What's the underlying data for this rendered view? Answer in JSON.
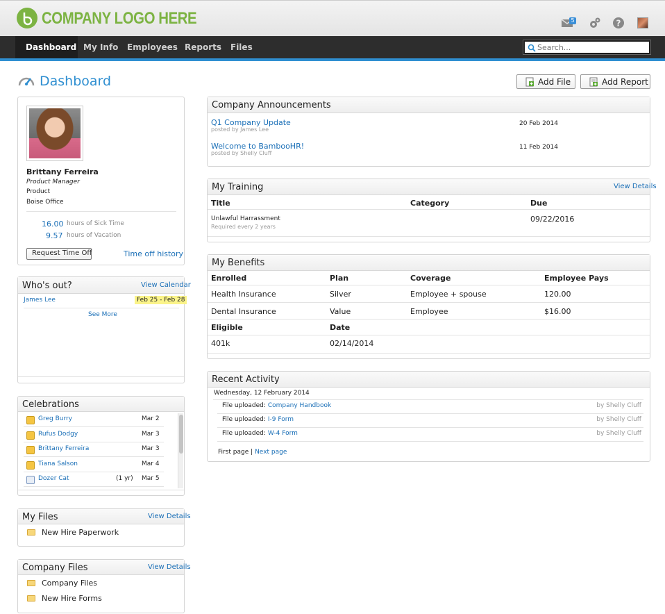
{
  "header": {
    "logo_text": "COMPANY LOGO HERE",
    "mail_count": "5"
  },
  "nav": {
    "items": [
      "Dashboard",
      "My Info",
      "Employees",
      "Reports",
      "Files"
    ],
    "search_placeholder": "Search..."
  },
  "page": {
    "title": "Dashboard",
    "add_file": "Add File",
    "add_report": "Add Report"
  },
  "profile": {
    "name": "Brittany Ferreira",
    "job_title": "Product Manager",
    "department": "Product",
    "location": "Boise Office",
    "sick_hours": "16.00",
    "sick_label": "hours of Sick Time",
    "vacation_hours": "9.57",
    "vacation_label": "hours of Vacation",
    "request_btn": "Request Time Off",
    "history_link": "Time off history"
  },
  "whos_out": {
    "title": "Who's out?",
    "link": "View Calendar",
    "person": "James Lee",
    "dates": "Feb 25 - Feb 28",
    "see_more": "See More"
  },
  "celebrations": {
    "title": "Celebrations",
    "items": [
      {
        "name": "Greg Burry",
        "extra": "",
        "date": "Mar 2"
      },
      {
        "name": "Rufus Dodgy",
        "extra": "",
        "date": "Mar 3"
      },
      {
        "name": "Brittany Ferreira",
        "extra": "",
        "date": "Mar 3"
      },
      {
        "name": "Tiana Salson",
        "extra": "",
        "date": "Mar 4"
      },
      {
        "name": "Dozer Cat",
        "extra": "(1 yr)",
        "date": "Mar 5"
      }
    ]
  },
  "my_files": {
    "title": "My Files",
    "link": "View Details",
    "items": [
      "New Hire Paperwork"
    ]
  },
  "company_files": {
    "title": "Company Files",
    "link": "View Details",
    "items": [
      "Company Files",
      "New Hire Forms"
    ]
  },
  "announcements": {
    "title": "Company Announcements",
    "items": [
      {
        "title": "Q1 Company Update",
        "by": "posted by James Lee",
        "date": "20 Feb 2014"
      },
      {
        "title": "Welcome to BambooHR!",
        "by": "posted by Shelly Cluff",
        "date": "11 Feb 2014"
      }
    ]
  },
  "training": {
    "title": "My Training",
    "link": "View Details",
    "columns": [
      "Title",
      "Category",
      "Due"
    ],
    "row": {
      "title": "Unlawful Harrassment",
      "sub": "Required every 2 years",
      "category": "",
      "due": "09/22/2016"
    }
  },
  "benefits": {
    "title": "My Benefits",
    "columns": [
      "Enrolled",
      "Plan",
      "Coverage",
      "Employee Pays"
    ],
    "rows": [
      {
        "name": "Health Insurance",
        "plan": "Silver",
        "coverage": "Employee + spouse",
        "pays": "120.00"
      },
      {
        "name": "Dental Insurance",
        "plan": "Value",
        "coverage": "Employee",
        "pays": "$16.00"
      }
    ],
    "eligible_columns": [
      "Eligible",
      "Date"
    ],
    "eligible_row": {
      "name": "401k",
      "date": "02/14/2014"
    }
  },
  "activity": {
    "title": "Recent Activity",
    "date": "Wednesday, 12 February 2014",
    "items": [
      {
        "label": "File uploaded:",
        "file": "Company Handbook",
        "by": "by Shelly Cluff"
      },
      {
        "label": "File uploaded:",
        "file": "I-9 Form",
        "by": "by Shelly Cluff"
      },
      {
        "label": "File uploaded:",
        "file": "W-4 Form",
        "by": "by Shelly Cluff"
      }
    ],
    "first_page": "First page",
    "sep": "|",
    "next_page": "Next page"
  }
}
